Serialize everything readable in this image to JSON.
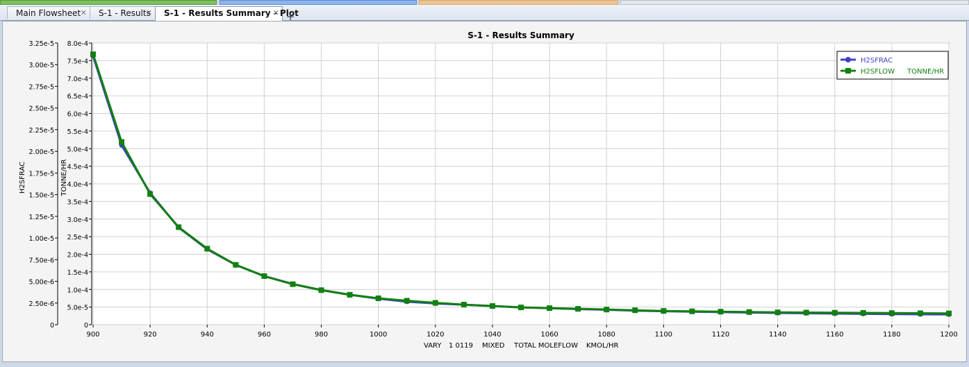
{
  "tabs": [
    {
      "label": "Main Flowsheet",
      "active": false
    },
    {
      "label": "S-1 - Results",
      "active": false
    },
    {
      "label": "S-1 - Results Summary - Plot",
      "active": true
    }
  ],
  "add_tab_icon": "plus-icon",
  "close_icon": "close-icon",
  "accent_colors": {
    "green": "#6aa84f",
    "blue": "#5b8fd6",
    "orange": "#d9a86c"
  },
  "chart_data": {
    "type": "line",
    "title": "S-1 - Results Summary",
    "xlabel": "VARY 1 0119 MIXED TOTAL MOLEFLOW KMOL/HR",
    "xlabel_parts": [
      "VARY",
      "1 0119",
      "MIXED",
      "TOTAL MOLEFLOW",
      "KMOL/HR"
    ],
    "ylabel_left": "H2SFRAC",
    "ylabel_right": "TONNE/HR",
    "xlim": [
      900,
      1200
    ],
    "ylim_left": [
      0,
      3.25e-05
    ],
    "ylim_right": [
      0,
      0.0008
    ],
    "x_ticks": [
      "900",
      "920",
      "940",
      "960",
      "980",
      "1000",
      "1020",
      "1040",
      "1060",
      "1080",
      "1100",
      "1120",
      "1140",
      "1160",
      "1180",
      "1200"
    ],
    "y_left_ticks": [
      "0",
      "2.50e-6",
      "5.00e-6",
      "7.50e-6",
      "1.00e-5",
      "1.25e-5",
      "1.50e-5",
      "1.75e-5",
      "2.00e-5",
      "2.25e-5",
      "2.50e-5",
      "2.75e-5",
      "3.00e-5",
      "3.25e-5"
    ],
    "y_right_ticks": [
      "0",
      "5.0e-5",
      "1.0e-4",
      "1.5e-4",
      "2.0e-4",
      "2.5e-4",
      "3.0e-4",
      "3.5e-4",
      "4.0e-4",
      "4.5e-4",
      "5.0e-4",
      "5.5e-4",
      "6.0e-4",
      "6.5e-4",
      "7.0e-4",
      "7.5e-4",
      "8.0e-4"
    ],
    "grid": true,
    "legend_position": "top-right",
    "x": [
      900,
      910,
      920,
      930,
      940,
      950,
      960,
      970,
      980,
      990,
      1000,
      1010,
      1020,
      1030,
      1040,
      1050,
      1060,
      1070,
      1080,
      1090,
      1100,
      1110,
      1120,
      1130,
      1140,
      1150,
      1160,
      1170,
      1180,
      1190,
      1200
    ],
    "series": [
      {
        "name": "H2SFRAC",
        "axis": "left",
        "color": "#4040c8",
        "marker": "circle",
        "values": [
          3.1e-05,
          2.07e-05,
          1.52e-05,
          1.12e-05,
          8.7e-06,
          6.9e-06,
          5.6e-06,
          4.7e-06,
          4e-06,
          3.45e-06,
          3e-06,
          2.65e-06,
          2.45e-06,
          2.3e-06,
          2.15e-06,
          2e-06,
          1.9e-06,
          1.8e-06,
          1.72e-06,
          1.62e-06,
          1.55e-06,
          1.5e-06,
          1.45e-06,
          1.4e-06,
          1.35e-06,
          1.32e-06,
          1.28e-06,
          1.25e-06,
          1.22e-06,
          1.2e-06,
          1.18e-06
        ]
      },
      {
        "name": "H2SFLOW",
        "unit": "TONNE/HR",
        "axis": "right",
        "color": "#128012",
        "marker": "square",
        "values": [
          0.000768,
          0.000519,
          0.000371,
          0.000277,
          0.000216,
          0.00017,
          0.000138,
          0.000115,
          9.8e-05,
          8.5e-05,
          7.5e-05,
          6.8e-05,
          6.2e-05,
          5.7e-05,
          5.3e-05,
          4.9e-05,
          4.7e-05,
          4.5e-05,
          4.3e-05,
          4.1e-05,
          3.9e-05,
          3.8e-05,
          3.7e-05,
          3.6e-05,
          3.5e-05,
          3.45e-05,
          3.4e-05,
          3.35e-05,
          3.3e-05,
          3.25e-05,
          3.2e-05
        ]
      }
    ]
  }
}
